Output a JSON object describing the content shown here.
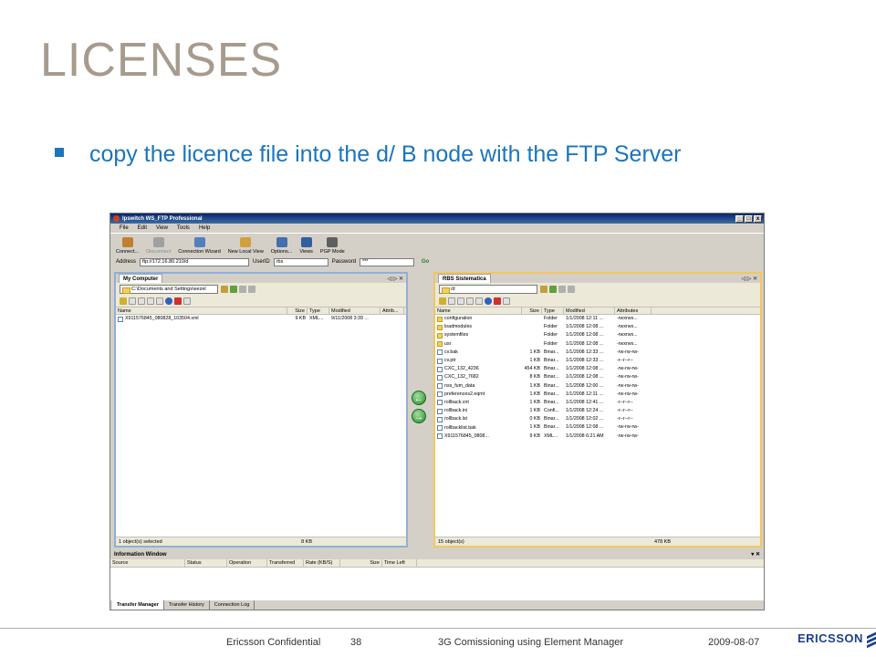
{
  "slide": {
    "title": "LICENSES",
    "bullet": "copy the licence file into the d/ B node with the FTP Server"
  },
  "app": {
    "title": "Ipswitch WS_FTP Professional",
    "window_controls": [
      "_",
      "□",
      "x"
    ],
    "menu": [
      "File",
      "Edit",
      "View",
      "Tools",
      "Help"
    ],
    "toolbar": [
      {
        "label": "Connect...",
        "icon": "connect-icon",
        "color": "#c08030",
        "disabled": false
      },
      {
        "label": "Disconnect",
        "icon": "disconnect-icon",
        "color": "#a0a0a0",
        "disabled": true
      },
      {
        "label": "Connection Wizard",
        "icon": "wizard-icon",
        "color": "#5080c0",
        "disabled": false
      },
      {
        "label": "New Local View",
        "icon": "local-view-icon",
        "color": "#d0a040",
        "disabled": false
      },
      {
        "label": "Options...",
        "icon": "options-icon",
        "color": "#4070b0",
        "disabled": false
      },
      {
        "label": "Views",
        "icon": "views-icon",
        "color": "#3060a0",
        "disabled": false
      },
      {
        "label": "PGP Mode",
        "icon": "pgp-icon",
        "color": "#606060",
        "disabled": false
      }
    ],
    "address_label": "Address",
    "address_value": "ftp://172.16.80.210/d",
    "userid_label": "UserID",
    "userid_value": "rbs",
    "password_label": "Password",
    "password_value": "***",
    "go_label": "Go"
  },
  "left_pane": {
    "tab": "My Computer",
    "path": "C:\\Documents and Settings\\eezel",
    "columns": [
      "Name",
      "Size",
      "Type",
      "Modified",
      "Attrib..."
    ],
    "files": [
      {
        "name": "X911576845_080828_103504.xml",
        "size": "9 KB",
        "type": "XML...",
        "modified": "9/11/2008 3:39 ...",
        "attrib": "",
        "kind": "file"
      }
    ],
    "status_left": "1 object(s) selected",
    "status_right": "8 KB"
  },
  "right_pane": {
    "tab": "RBS Sistematica",
    "path": "/d",
    "columns": [
      "Name",
      "Size",
      "Type",
      "Modified",
      "Attributes"
    ],
    "files": [
      {
        "name": "configuration",
        "size": "",
        "type": "Folder",
        "modified": "1/1/2008 12:11 ...",
        "attrib": "-rwxrwx...",
        "kind": "folder"
      },
      {
        "name": "loadmodules",
        "size": "",
        "type": "Folder",
        "modified": "1/1/2008 12:08 ...",
        "attrib": "-rwxrwx...",
        "kind": "folder"
      },
      {
        "name": "systemfiles",
        "size": "",
        "type": "Folder",
        "modified": "1/1/2008 12:08 ...",
        "attrib": "-rwxrwx...",
        "kind": "folder"
      },
      {
        "name": "usr",
        "size": "",
        "type": "Folder",
        "modified": "1/1/2008 12:08 ...",
        "attrib": "-rwxrwx...",
        "kind": "folder"
      },
      {
        "name": "cv.bak",
        "size": "1 KB",
        "type": "Binar...",
        "modified": "1/1/2008 12:33 ...",
        "attrib": "-rw-rw-rw-",
        "kind": "file"
      },
      {
        "name": "cv.ptr",
        "size": "1 KB",
        "type": "Binar...",
        "modified": "1/1/2008 12:33 ...",
        "attrib": "-r--r--r--",
        "kind": "file"
      },
      {
        "name": "CXC_132_4236",
        "size": "454 KB",
        "type": "Binar...",
        "modified": "1/1/2008 12:08 ...",
        "attrib": "-rw-rw-rw-",
        "kind": "file"
      },
      {
        "name": "CXC_132_7682",
        "size": "8 KB",
        "type": "Binar...",
        "modified": "1/1/2008 12:08 ...",
        "attrib": "-rw-rw-rw-",
        "kind": "file"
      },
      {
        "name": "nss_fum_data",
        "size": "1 KB",
        "type": "Binar...",
        "modified": "1/1/2008 12:00 ...",
        "attrib": "-rw-rw-rw-",
        "kind": "file"
      },
      {
        "name": "preferences2.eqmt",
        "size": "1 KB",
        "type": "Binar...",
        "modified": "1/1/2008 12:11 ...",
        "attrib": "-rw-rw-rw-",
        "kind": "file"
      },
      {
        "name": "rollback.cnt",
        "size": "1 KB",
        "type": "Binar...",
        "modified": "1/1/2008 12:41 ...",
        "attrib": "-r--r--r--",
        "kind": "file"
      },
      {
        "name": "rollback.ini",
        "size": "1 KB",
        "type": "Confi...",
        "modified": "1/1/2008 12:24 ...",
        "attrib": "-r--r--r--",
        "kind": "file"
      },
      {
        "name": "rollback.lst",
        "size": "0 KB",
        "type": "Binar...",
        "modified": "1/1/2008 12:02 ...",
        "attrib": "-r--r--r--",
        "kind": "file"
      },
      {
        "name": "rollbacklist.bak",
        "size": "1 KB",
        "type": "Binar...",
        "modified": "1/1/2008 12:08 ...",
        "attrib": "-rw-rw-rw-",
        "kind": "file"
      },
      {
        "name": "X911576845_0808...",
        "size": "9 KB",
        "type": "XML...",
        "modified": "1/1/2008 6:21 AM",
        "attrib": "-rw-rw-rw-",
        "kind": "file"
      }
    ],
    "status_left": "15 object(s)",
    "status_right": "478 KB"
  },
  "transfer": {
    "left_arrow": "←",
    "right_arrow": "→"
  },
  "info_window": {
    "title": "Information Window",
    "controls": "▾ ✕",
    "columns": [
      "Source",
      "Status",
      "Operation",
      "Transferred",
      "Rate (KB/S)",
      "Size",
      "Time Left"
    ],
    "tabs": [
      "Transfer Manager",
      "Transfer History",
      "Connection Log"
    ]
  },
  "footer": {
    "confidential": "Ericsson Confidential",
    "page": "38",
    "course": "3G Comissioning using Element Manager",
    "date": "2009-08-07",
    "logo": "ERICSSON"
  },
  "colors": {
    "title": "#a69b8e",
    "bullet": "#1b75bc",
    "logo": "#1b3f8f"
  }
}
